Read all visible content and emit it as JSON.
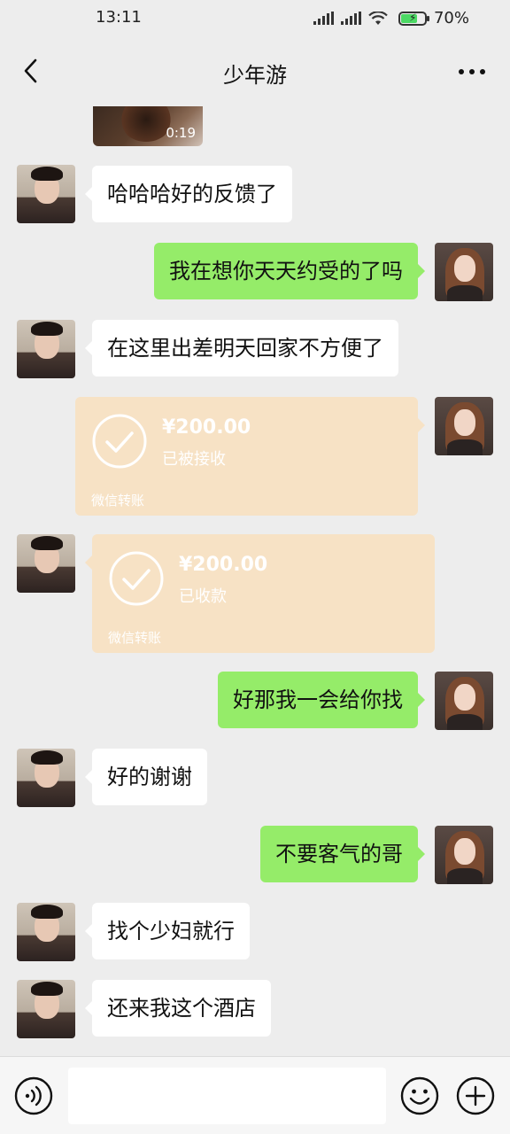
{
  "status_bar": {
    "time": "13:11",
    "battery_pct": "70%",
    "battery_level": 0.7
  },
  "header": {
    "title": "少年游"
  },
  "video": {
    "duration": "0:19"
  },
  "messages": [
    {
      "side": "in",
      "text": "哈哈哈好的反馈了"
    },
    {
      "side": "out",
      "text": "我在想你天天约受的了吗"
    },
    {
      "side": "in",
      "text": "在这里出差明天回家不方便了"
    },
    {
      "side": "out",
      "type": "transfer",
      "amount": "¥200.00",
      "status": "已被接收",
      "label": "微信转账"
    },
    {
      "side": "in",
      "type": "transfer",
      "amount": "¥200.00",
      "status": "已收款",
      "label": "微信转账"
    },
    {
      "side": "out",
      "text": "好那我一会给你找"
    },
    {
      "side": "in",
      "text": "好的谢谢"
    },
    {
      "side": "out",
      "text": "不要客气的哥"
    },
    {
      "side": "in",
      "text": "找个少妇就行"
    },
    {
      "side": "in",
      "text": "还来我这个酒店"
    }
  ],
  "input": {
    "value": "",
    "placeholder": ""
  },
  "colors": {
    "background": "#ededed",
    "bubble_out": "#95ec69",
    "bubble_in": "#ffffff",
    "transfer": "#f7e2c5"
  },
  "icons": [
    "back-icon",
    "more-icon",
    "voice-icon",
    "emoji-icon",
    "plus-icon",
    "check-icon"
  ]
}
